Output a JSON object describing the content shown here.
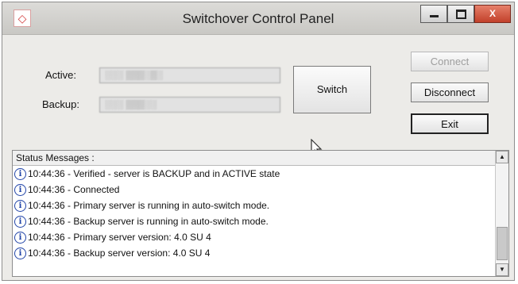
{
  "window": {
    "title": "Switchover Control Panel",
    "app_icon": "app-logo-icon",
    "controls": {
      "minimize": "minimize-icon",
      "maximize": "maximize-icon",
      "close": "X"
    }
  },
  "fields": {
    "active_label": "Active:",
    "active_value": "░░░ ▒▒▒░▒░",
    "backup_label": "Backup:",
    "backup_value": "░░░ ▒▒▒░░"
  },
  "buttons": {
    "switch": "Switch",
    "connect": "Connect",
    "disconnect": "Disconnect",
    "exit": "Exit"
  },
  "status": {
    "header": "Status Messages :",
    "icon": "info-icon",
    "messages": [
      "10:44:36 - Verified - server is BACKUP and in ACTIVE state",
      "10:44:36 - Connected",
      "10:44:36 - Primary server is running in auto-switch mode.",
      "10:44:36 - Backup server is running in auto-switch mode.",
      "10:44:36 - Primary server version: 4.0 SU 4",
      "10:44:36 - Backup server version: 4.0 SU 4"
    ]
  },
  "colors": {
    "window_bg": "#ecebe8",
    "close_button": "#c2402a",
    "info_icon": "#2245a8",
    "disabled_text": "#9d9d9d"
  }
}
